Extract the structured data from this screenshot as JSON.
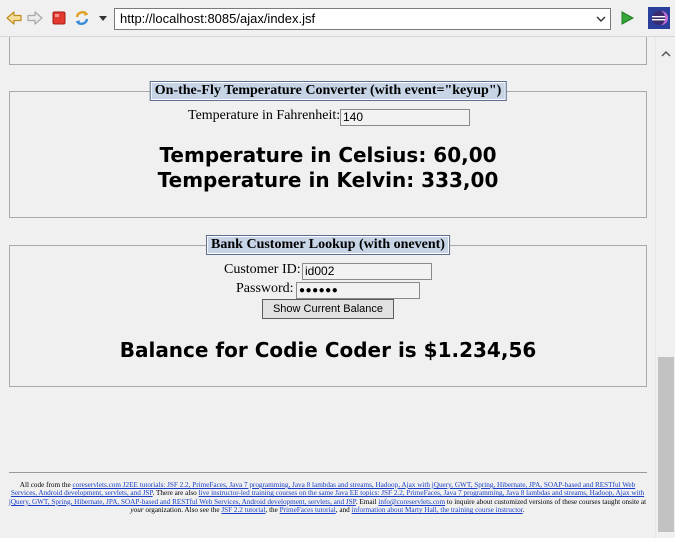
{
  "browser": {
    "url": "http://localhost:8085/ajax/index.jsf"
  },
  "temp_panel": {
    "legend": "On-the-Fly Temperature Converter (with event=\"keyup\")",
    "fahrenheit_label": "Temperature in Fahrenheit:",
    "fahrenheit_value": "140",
    "celsius_text": "Temperature in Celsius: 60,00",
    "kelvin_text": "Temperature in Kelvin: 333,00"
  },
  "bank_panel": {
    "legend": "Bank Customer Lookup (with onevent)",
    "customer_id_label": "Customer ID:",
    "customer_id_value": "id002",
    "password_label": "Password:",
    "password_value": "●●●●●●",
    "button_label": "Show Current Balance",
    "balance_text": "Balance for Codie Coder is $1.234,56"
  },
  "footer": {
    "t1": "All code from the ",
    "l1": "coreservlets.com J2EE tutorials: JSF 2.2, PrimeFaces, Java 7 programming, Java 8 lambdas and streams, Hadoop, Ajax with jQuery, GWT, Spring, Hibernate, JPA, SOAP-based and RESTful Web Services, Android development, servlets, and JSP",
    "t2": ". There are also ",
    "l2": "live instructor-led training courses on the same Java EE topics: JSF 2.2, PrimeFaces, Java 7 programming, Java 8 lambdas and streams, Hadoop, Ajax with jQuery, GWT, Spring, Hibernate, JPA, SOAP-based and RESTful Web Services, Android development, servlets, and JSP",
    "t3": ". Email ",
    "l3": "info@coreservlets.com",
    "t4": " to inquire about customized versions of these courses taught onsite at ",
    "t4em": "your",
    "t5": " organization. Also see the ",
    "l4": "JSF 2.2 tutorial",
    "t6": ", the ",
    "l5": "PrimeFaces tutorial",
    "t7": ", and ",
    "l6": "information about Marty Hall, the training course instructor",
    "t8": "."
  },
  "icons": {
    "back": "arrow-left-icon",
    "forward": "arrow-right-icon",
    "stop": "stop-icon",
    "refresh": "refresh-icon",
    "menu": "dropdown-icon",
    "go": "go-icon",
    "eclipse": "eclipse-icon"
  }
}
